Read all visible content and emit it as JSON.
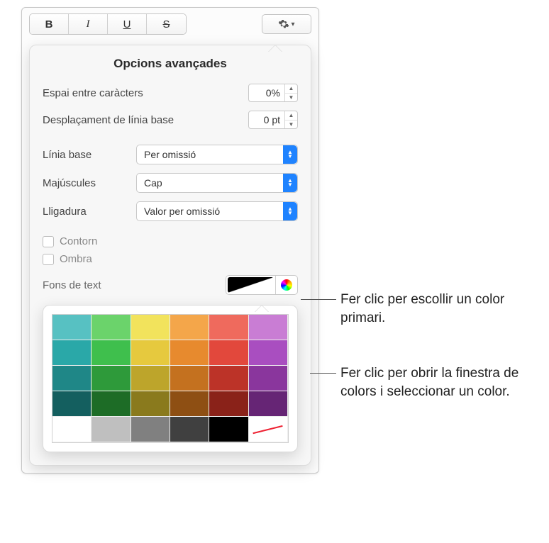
{
  "toolbar": {
    "bold": "B",
    "italic": "I",
    "underline": "U",
    "strike": "S"
  },
  "popover": {
    "title": "Opcions avançades",
    "char_spacing": {
      "label": "Espai entre caràcters",
      "value": "0%"
    },
    "baseline_shift": {
      "label": "Desplaçament de línia base",
      "value": "0 pt"
    },
    "baseline": {
      "label": "Línia base",
      "value": "Per omissió"
    },
    "caps": {
      "label": "Majúscules",
      "value": "Cap"
    },
    "ligature": {
      "label": "Lligadura",
      "value": "Valor per omissió"
    },
    "outline": "Contorn",
    "shadow": "Ombra",
    "textbg": "Fons de text"
  },
  "swatches": [
    [
      "#57c1c2",
      "#6bd36b",
      "#f2e35c",
      "#f4a64a",
      "#ef6a5d",
      "#c97dd4"
    ],
    [
      "#2aa8a8",
      "#3fbf4d",
      "#e6c93e",
      "#e78a2e",
      "#e2483c",
      "#a94ec0"
    ],
    [
      "#1f8787",
      "#2e9a3a",
      "#bda52b",
      "#c4711f",
      "#bc3328",
      "#8a369d"
    ],
    [
      "#145f5f",
      "#1d6c26",
      "#8a7a1d",
      "#8e4f13",
      "#8a2219",
      "#662575"
    ],
    [
      "#ffffff",
      "#bfbfbf",
      "#808080",
      "#404040",
      "#000000",
      "none"
    ]
  ],
  "callouts": {
    "primary": "Fer clic per escollir un color primari.",
    "window": "Fer clic per obrir la finestra de colors i seleccionar un color."
  }
}
